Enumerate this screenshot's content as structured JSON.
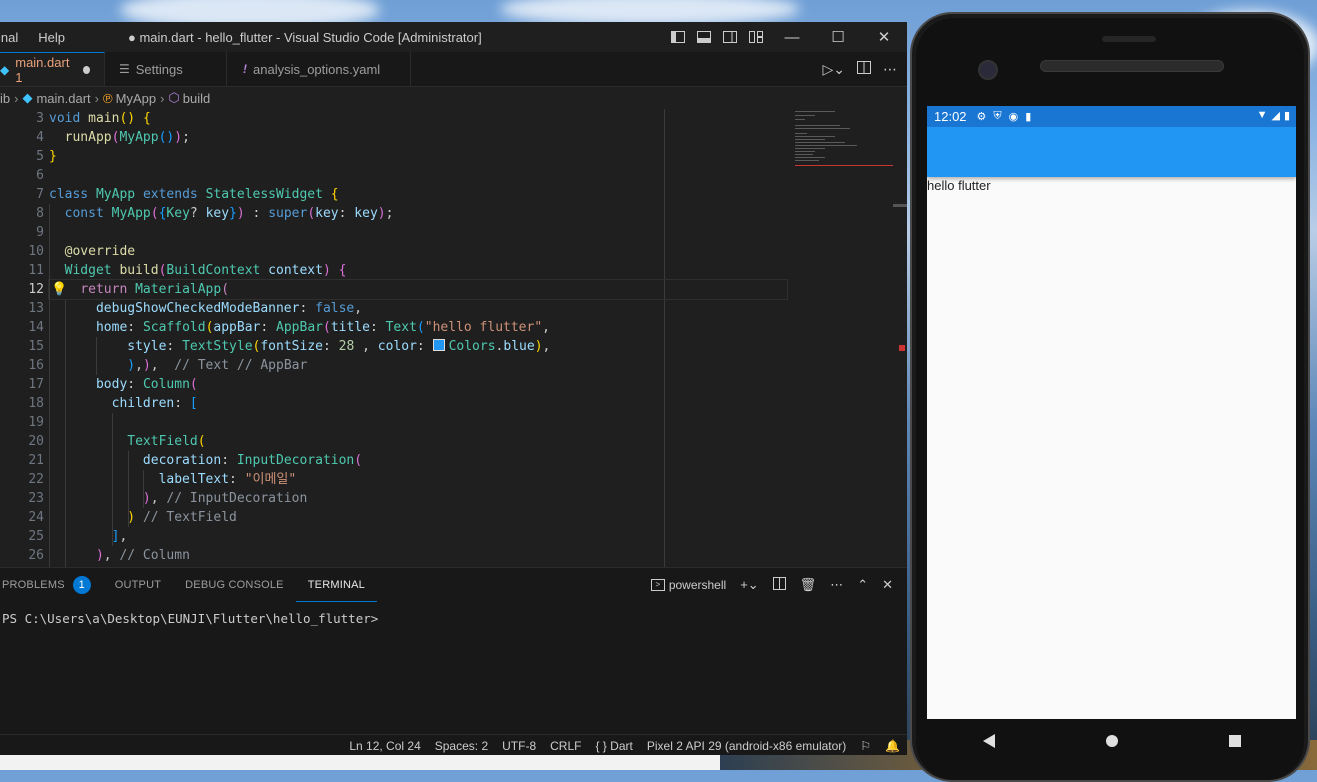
{
  "vscode": {
    "menu": [
      "inal",
      "Help"
    ],
    "window_title": "● main.dart - hello_flutter - Visual Studio Code [Administrator]",
    "tabs": [
      {
        "label": "main.dart 1",
        "active": true,
        "modified": true,
        "icon": "dart-icon"
      },
      {
        "label": "Settings",
        "active": false,
        "icon": "settings-list-icon"
      },
      {
        "label": "analysis_options.yaml",
        "active": false,
        "icon": "yaml-exclamation-icon"
      }
    ],
    "breadcrumb": {
      "folder": "ib",
      "file": "main.dart",
      "class": "MyApp",
      "method": "build"
    },
    "line_numbers": [
      "3",
      "4",
      "5",
      "6",
      "7",
      "8",
      "9",
      "10",
      "11",
      "12",
      "13",
      "14",
      "15",
      "16",
      "17",
      "18",
      "19",
      "20",
      "21",
      "22",
      "23",
      "24",
      "25",
      "26"
    ],
    "current_line": "12",
    "code_tokens": {
      "void": "void",
      "main": "main",
      "runApp": "runApp",
      "MyApp": "MyApp",
      "class": "class",
      "extends": "extends",
      "StatelessWidget": "StatelessWidget",
      "const": "const",
      "Key": "Key",
      "key": "key",
      "super": "super",
      "override": "@override",
      "Widget": "Widget",
      "build": "build",
      "BuildContext": "BuildContext",
      "context": "context",
      "return": "return",
      "MaterialApp": "MaterialApp",
      "debugShowCheckedModeBanner": "debugShowCheckedModeBanner",
      "false": "false",
      "home": "home",
      "Scaffold": "Scaffold",
      "appBar": "appBar",
      "AppBar": "AppBar",
      "title": "title",
      "Text": "Text",
      "hello_flutter_str": "\"hello flutter\"",
      "style": "style",
      "TextStyle": "TextStyle",
      "fontSize": "fontSize",
      "num28": "28",
      "color": "color",
      "Colors": "Colors",
      "blue": "blue",
      "comment_appbar": "// Text // AppBar",
      "body": "body",
      "Column": "Column",
      "children": "children",
      "TextField": "TextField",
      "decoration": "decoration",
      "InputDecoration": "InputDecoration",
      "labelText": "labelText",
      "email_str": "\"이메일\"",
      "comment_inputdecoration": "// InputDecoration",
      "comment_textfield": "// TextField",
      "comment_column": "// Column"
    },
    "panel": {
      "tabs": [
        "PROBLEMS",
        "OUTPUT",
        "DEBUG CONSOLE",
        "TERMINAL"
      ],
      "problems_count": "1",
      "active_tab": "TERMINAL",
      "shell": "powershell",
      "prompt": "PS C:\\Users\\a\\Desktop\\EUNJI\\Flutter\\hello_flutter>"
    },
    "status": {
      "position": "Ln 12, Col 24",
      "spaces": "Spaces: 2",
      "encoding": "UTF-8",
      "eol": "CRLF",
      "language": "Dart",
      "language_icon": "{ }",
      "device": "Pixel 2 API 29 (android-x86 emulator)"
    }
  },
  "emulator": {
    "time": "12:02",
    "body_text": "hello flutter",
    "appbar_color": "#2196f3",
    "statusbar_color": "#1976d2"
  }
}
